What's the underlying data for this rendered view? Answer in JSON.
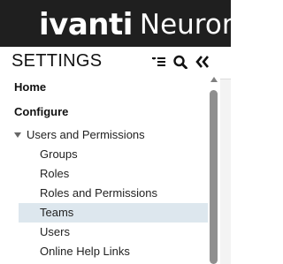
{
  "topbar": {
    "logo_text": "ivanti",
    "product_text": "Neurons"
  },
  "settings": {
    "title": "SETTINGS",
    "icons": {
      "list": "list-collapse-icon",
      "search": "search-icon",
      "collapse": "double-chevron-left-icon"
    }
  },
  "nav": {
    "home": "Home",
    "configure": "Configure",
    "group_label": "Users and Permissions",
    "children": [
      {
        "label": "Groups"
      },
      {
        "label": "Roles"
      },
      {
        "label": "Roles and Permissions"
      },
      {
        "label": "Teams",
        "selected": true
      },
      {
        "label": "Users"
      },
      {
        "label": "Online Help Links"
      }
    ]
  }
}
